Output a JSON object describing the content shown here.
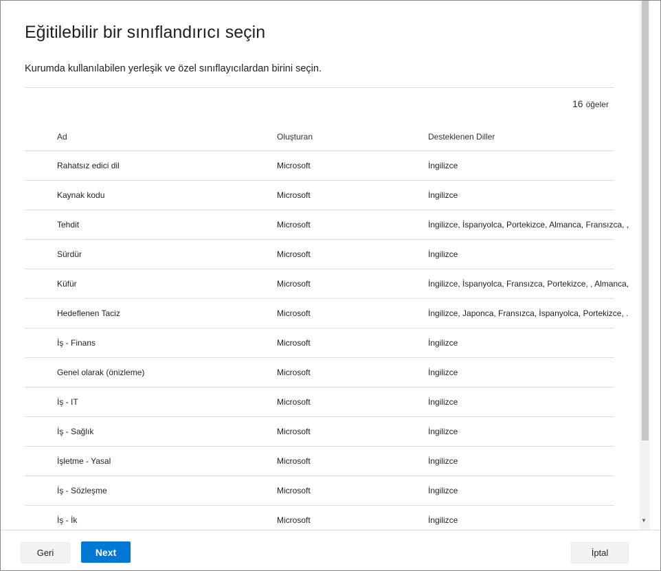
{
  "dialog": {
    "title": "Eğitilebilir bir sınıflandırıcı seçin",
    "subtitle": "Kurumda kullanılabilen yerleşik ve özel sınıflayıcılardan birini seçin.",
    "count_number": "16",
    "count_label": "öğeler"
  },
  "table": {
    "headers": [
      "Ad",
      "Oluşturan",
      "Desteklenen Diller"
    ],
    "rows": [
      {
        "name": "Rahatsız edici dil",
        "creator": "Microsoft",
        "languages": "İngilizce"
      },
      {
        "name": "Kaynak kodu",
        "creator": "Microsoft",
        "languages": "İngilizce"
      },
      {
        "name": "Tehdit",
        "creator": "Microsoft",
        "languages": "İngilizce, İspanyolca, Portekizce, Almanca, Fransızca, , ..."
      },
      {
        "name": "Sürdür",
        "creator": "Microsoft",
        "languages": "İngilizce"
      },
      {
        "name": "Küfür",
        "creator": "Microsoft",
        "languages": "İngilizce, İspanyolca, Fransızca, Portekizce, , Almanca, ..."
      },
      {
        "name": "Hedeflenen Taciz",
        "creator": "Microsoft",
        "languages": "İngilizce, Japonca, Fransızca, İspanyolca, Portekizce, ."
      },
      {
        "name": "İş - Finans",
        "creator": "Microsoft",
        "languages": "İngilizce"
      },
      {
        "name": "Genel olarak (önizleme)",
        "creator": "Microsoft",
        "languages": "İngilizce"
      },
      {
        "name": "İş - IT",
        "creator": "Microsoft",
        "languages": "İngilizce"
      },
      {
        "name": "İş - Sağlık",
        "creator": "Microsoft",
        "languages": "İngilizce"
      },
      {
        "name": "İşletme - Yasal",
        "creator": "Microsoft",
        "languages": "İngilizce"
      },
      {
        "name": "İş - Sözleşme",
        "creator": "Microsoft",
        "languages": "İngilizce"
      },
      {
        "name": "İş - İk",
        "creator": "Microsoft",
        "languages": "İngilizce"
      }
    ]
  },
  "footer": {
    "back_label": "Geri",
    "next_label": "Next",
    "cancel_label": "İptal"
  },
  "scrollbar": {
    "down_arrow_icon": "chevron-down-icon"
  },
  "colors": {
    "accent": "#0078d4",
    "divider": "#e1dfdd"
  }
}
